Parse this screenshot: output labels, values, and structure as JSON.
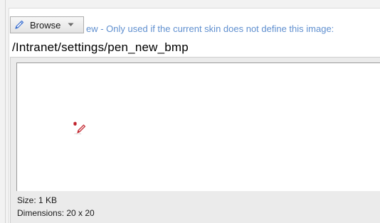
{
  "toolbar": {
    "browse_label": "Browse",
    "browse_icon": "pen-icon",
    "dropdown_icon": "chevron-down-icon"
  },
  "hint_text": "ew - Only used if the current skin does not define this image:",
  "image_path": "/Intranet/settings/pen_new_bmp",
  "preview": {
    "image_icon": "pen-new-icon",
    "size_text": "Size: 1 KB",
    "dimensions_text": "Dimensions: 20 x 20"
  },
  "colors": {
    "hint": "#5f8fcf",
    "pen_accent": "#3a6fd0",
    "preview_icon": "#c0202a"
  }
}
